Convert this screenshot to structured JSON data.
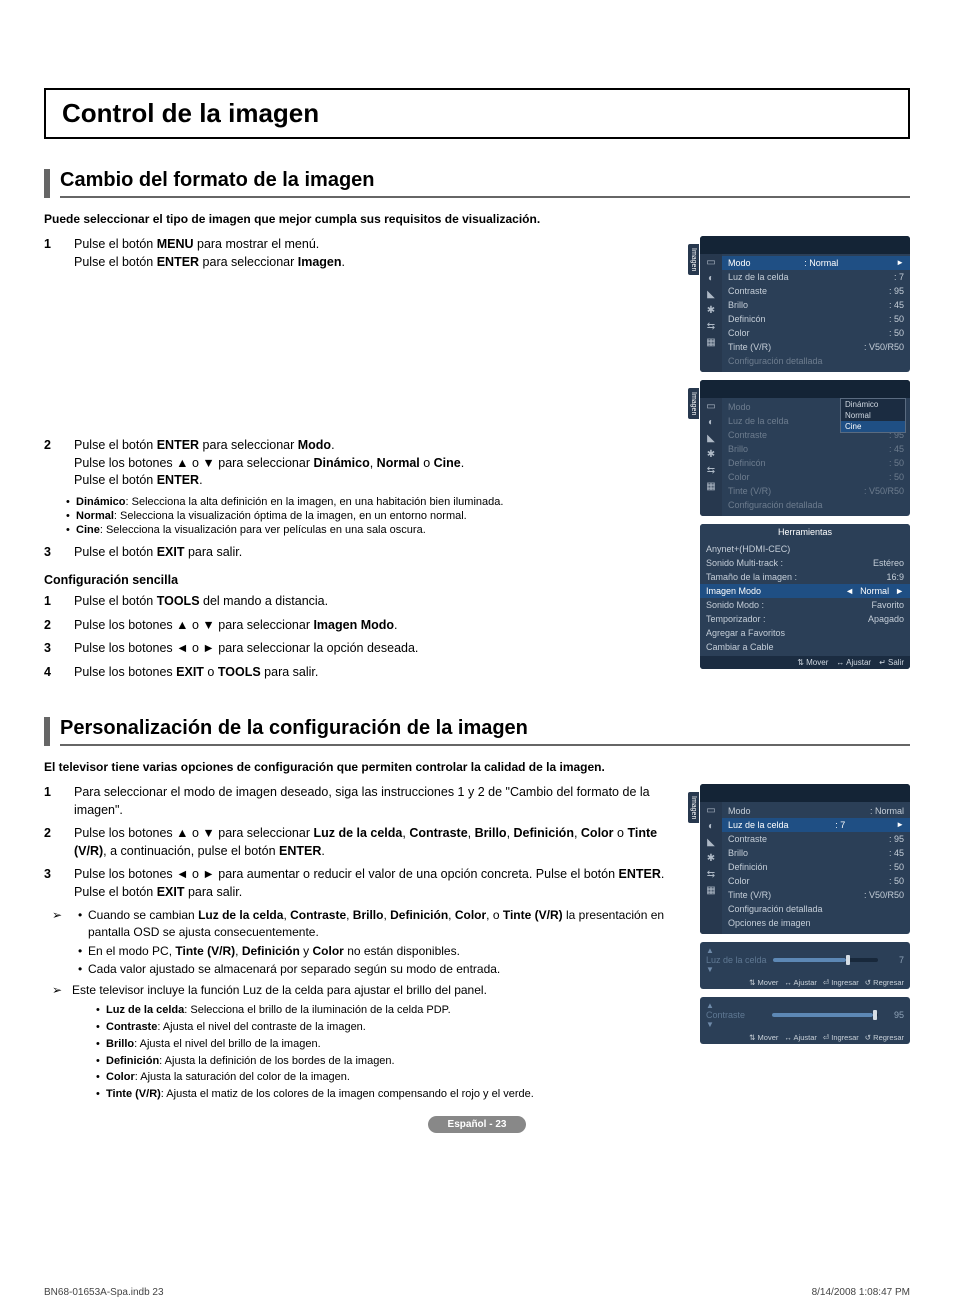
{
  "main_title": "Control de la imagen",
  "section1": {
    "title": "Cambio del formato de la imagen",
    "intro": "Puede seleccionar el tipo de imagen que mejor cumpla sus requisitos de visualización.",
    "step1": "Pulse el botón MENU para mostrar el menú.\nPulse el botón ENTER para seleccionar Imagen.",
    "step2": "Pulse el botón ENTER para seleccionar Modo.\nPulse los botones ▲ o ▼ para seleccionar Dinámico, Normal o Cine.\nPulse el botón ENTER.",
    "bullets": [
      "Dinámico: Selecciona la alta definición en la imagen, en una habitación bien iluminada.",
      "Normal: Selecciona la visualización óptima de la imagen, en un entorno normal.",
      "Cine: Selecciona la visualización para ver películas en una sala oscura."
    ],
    "step3": "Pulse el botón EXIT para salir.",
    "simple_title": "Configuración sencilla",
    "simple_steps": [
      "Pulse el botón TOOLS del mando a distancia.",
      "Pulse los botones ▲ o ▼ para seleccionar Imagen Modo.",
      "Pulse los botones ◄ o ► para seleccionar la opción deseada.",
      "Pulse los botones EXIT o TOOLS para salir."
    ]
  },
  "section2": {
    "title": "Personalización de la configuración de la imagen",
    "intro": "El televisor tiene varias opciones de configuración que permiten controlar la calidad de la imagen.",
    "step1": "Para seleccionar el modo de imagen deseado, siga las instrucciones 1 y 2 de \"Cambio del formato de la imagen\".",
    "step2": "Pulse los botones ▲ o ▼ para seleccionar Luz de la celda, Contraste, Brillo, Definición, Color o Tinte (V/R), a continuación, pulse el botón ENTER.",
    "step3": "Pulse los botones ◄ o ► para aumentar o reducir el valor de una opción concreta. Pulse el botón ENTER.\nPulse el botón EXIT para salir.",
    "pointer_bullets": [
      "Cuando se cambian Luz de la celda, Contraste, Brillo, Definición, Color, o Tinte (V/R) la presentación en pantalla OSD se ajusta consecuentemente.",
      "En el modo PC, Tinte (V/R), Definición y Color no están disponibles.",
      "Cada valor ajustado se almacenará por separado según su modo de entrada."
    ],
    "pointer2": "Este televisor incluye la función Luz de la celda para ajustar el brillo del panel.",
    "defs": [
      "Luz de la celda: Selecciona el brillo de la iluminación de la celda PDP.",
      "Contraste: Ajusta el nivel del contraste de la imagen.",
      "Brillo: Ajusta el nivel del brillo de la imagen.",
      "Definición: Ajusta la definición de los bordes de la imagen.",
      "Color: Ajusta la saturación del color de la imagen.",
      "Tinte (V/R): Ajusta el matiz de los colores de la imagen compensando el rojo y el verde."
    ]
  },
  "osd1": {
    "tab": "Imagen",
    "rows": [
      {
        "label": "Modo",
        "value": ": Normal",
        "sel": true,
        "arrow": true
      },
      {
        "label": "Luz de la celda",
        "value": ": 7"
      },
      {
        "label": "Contraste",
        "value": ": 95"
      },
      {
        "label": "Brillo",
        "value": ": 45"
      },
      {
        "label": "Definicón",
        "value": ": 50"
      },
      {
        "label": "Color",
        "value": ": 50"
      },
      {
        "label": "Tinte (V/R)",
        "value": ": V50/R50"
      },
      {
        "label": "Configuración detallada",
        "value": "",
        "dim": true
      }
    ]
  },
  "osd2": {
    "tab": "Imagen",
    "dropdown": [
      "Dinámico",
      "Normal",
      "Cine"
    ],
    "drop_sel": "Cine",
    "rows": [
      {
        "label": "Modo",
        "value": "",
        "dim": true
      },
      {
        "label": "Luz de la celda",
        "value": ": 7",
        "dim": true
      },
      {
        "label": "Contraste",
        "value": ": 95",
        "dim": true
      },
      {
        "label": "Brillo",
        "value": ": 45",
        "dim": true
      },
      {
        "label": "Definicón",
        "value": ": 50",
        "dim": true
      },
      {
        "label": "Color",
        "value": ": 50",
        "dim": true
      },
      {
        "label": "Tinte (V/R)",
        "value": ": V50/R50",
        "dim": true
      },
      {
        "label": "Configuración detallada",
        "value": "",
        "dim": true
      }
    ]
  },
  "tools": {
    "title": "Herramientas",
    "rows": [
      {
        "label": "Anynet+(HDMI-CEC)",
        "value": ""
      },
      {
        "label": "Sonido Multi-track   :",
        "value": "Estéreo"
      },
      {
        "label": "Tamaño de la imagen :",
        "value": "16:9"
      },
      {
        "label": "Imagen Modo",
        "value": "Normal",
        "sel": true,
        "arrows": true
      },
      {
        "label": "Sonido Modo        :",
        "value": "Favorito"
      },
      {
        "label": "Temporizador        :",
        "value": "Apagado"
      },
      {
        "label": "Agregar a Favoritos",
        "value": ""
      },
      {
        "label": "Cambiar a Cable",
        "value": ""
      }
    ],
    "foot": [
      "Mover",
      "Ajustar",
      "Salir"
    ]
  },
  "osd3": {
    "tab": "Imagen",
    "rows": [
      {
        "label": "Modo",
        "value": ": Normal"
      },
      {
        "label": "Luz de la celda",
        "value": ": 7",
        "sel": true,
        "arrow": true
      },
      {
        "label": "Contraste",
        "value": ": 95"
      },
      {
        "label": "Brillo",
        "value": ": 45"
      },
      {
        "label": "Definición",
        "value": ": 50"
      },
      {
        "label": "Color",
        "value": ": 50"
      },
      {
        "label": "Tinte (V/R)",
        "value": ": V50/R50"
      },
      {
        "label": "Configuración detallada",
        "value": ""
      },
      {
        "label": "Opciones de imagen",
        "value": ""
      }
    ]
  },
  "slider1": {
    "name": "Luz de la celda",
    "value": "7",
    "pct": 70,
    "foot": [
      "Mover",
      "Ajustar",
      "Ingresar",
      "Regresar"
    ]
  },
  "slider2": {
    "name": "Contraste",
    "value": "95",
    "pct": 95,
    "foot": [
      "Mover",
      "Ajustar",
      "Ingresar",
      "Regresar"
    ]
  },
  "page_badge": "Español - 23",
  "footer_left": "BN68-01653A-Spa.indb   23",
  "footer_right": "8/14/2008   1:08:47 PM"
}
